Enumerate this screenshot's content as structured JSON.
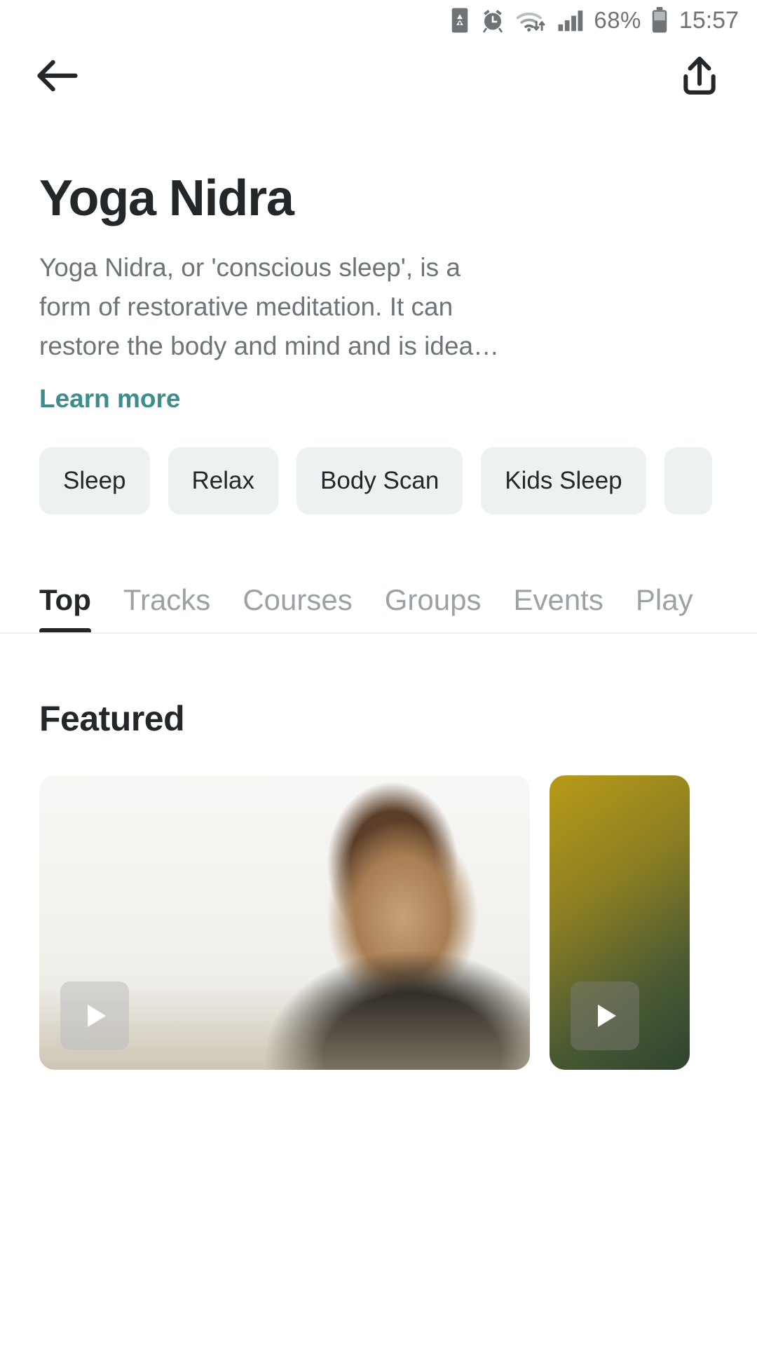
{
  "status_bar": {
    "battery_percent": "68%",
    "time": "15:57",
    "icons": [
      "sim-card-icon",
      "alarm-icon",
      "wifi-icon",
      "signal-icon",
      "battery-icon"
    ]
  },
  "nav": {
    "back_label": "back-arrow",
    "share_label": "share"
  },
  "header": {
    "title": "Yoga Nidra",
    "description": "Yoga Nidra, or 'conscious sleep', is a form of restorative meditation. It can restore the body and mind and is idea…",
    "learn_more": "Learn more",
    "link_color": "#3c8d8b"
  },
  "chips": [
    {
      "label": "Sleep"
    },
    {
      "label": "Relax"
    },
    {
      "label": "Body Scan"
    },
    {
      "label": "Kids Sleep"
    },
    {
      "label": ""
    }
  ],
  "tabs": [
    {
      "label": "Top",
      "active": true
    },
    {
      "label": "Tracks",
      "active": false
    },
    {
      "label": "Courses",
      "active": false
    },
    {
      "label": "Groups",
      "active": false
    },
    {
      "label": "Events",
      "active": false
    },
    {
      "label": "Play",
      "active": false
    }
  ],
  "featured": {
    "section_title": "Featured",
    "cards": [
      {
        "play_label": "play"
      },
      {
        "play_label": "play"
      }
    ]
  },
  "colors": {
    "text_primary": "#23272a",
    "text_secondary": "#6d7478",
    "accent_teal": "#3c8d8b",
    "chip_bg": "#eef1f2",
    "status_icon": "#6f7376"
  }
}
